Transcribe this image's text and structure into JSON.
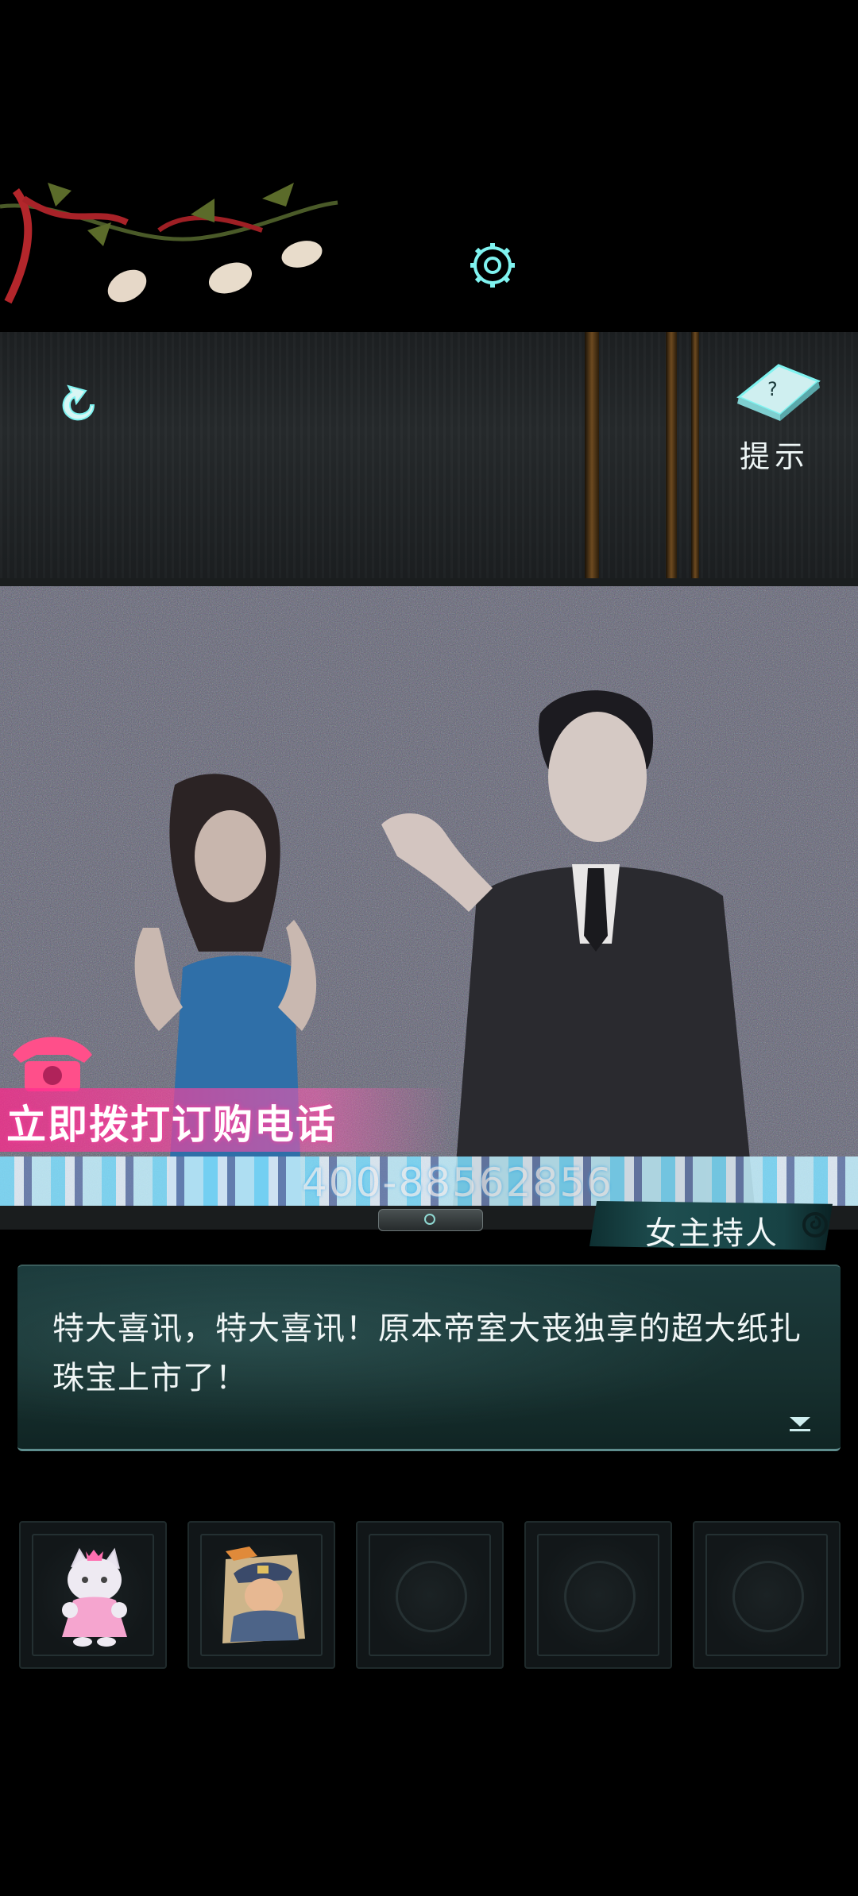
{
  "hud": {
    "hint_label": "提示"
  },
  "tv": {
    "order_banner": "立即拨打订购电话",
    "phone_number": "400-88562856"
  },
  "dialogue": {
    "speaker": "女主持人",
    "text": "特大喜讯，特大喜讯！原本帝室大丧独享的超大纸扎珠宝上市了！"
  },
  "inventory": {
    "slots": [
      {
        "item": "pink-kitten-plush"
      },
      {
        "item": "policeman-paper-cutout"
      },
      {
        "item": "empty"
      },
      {
        "item": "empty"
      },
      {
        "item": "empty"
      }
    ]
  },
  "colors": {
    "accent": "#7ff3f0",
    "banner_pink": "#ff3fa0",
    "dialogue_bg": "#17302f"
  }
}
